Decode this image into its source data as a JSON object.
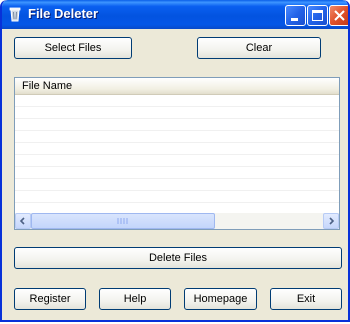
{
  "window": {
    "title": "File Deleter",
    "titlebar_buttons": [
      "minimize-icon",
      "maximize-icon",
      "close-icon"
    ]
  },
  "toolbar": {
    "select_files_label": "Select Files",
    "clear_label": "Clear"
  },
  "file_list": {
    "columns": [
      "File Name"
    ],
    "rows": []
  },
  "actions": {
    "delete_files_label": "Delete Files"
  },
  "footer": {
    "register_label": "Register",
    "help_label": "Help",
    "homepage_label": "Homepage",
    "exit_label": "Exit"
  },
  "colors": {
    "titlebar": "#0353e0",
    "window_face": "#ece9d8",
    "close_button": "#e0512a"
  }
}
